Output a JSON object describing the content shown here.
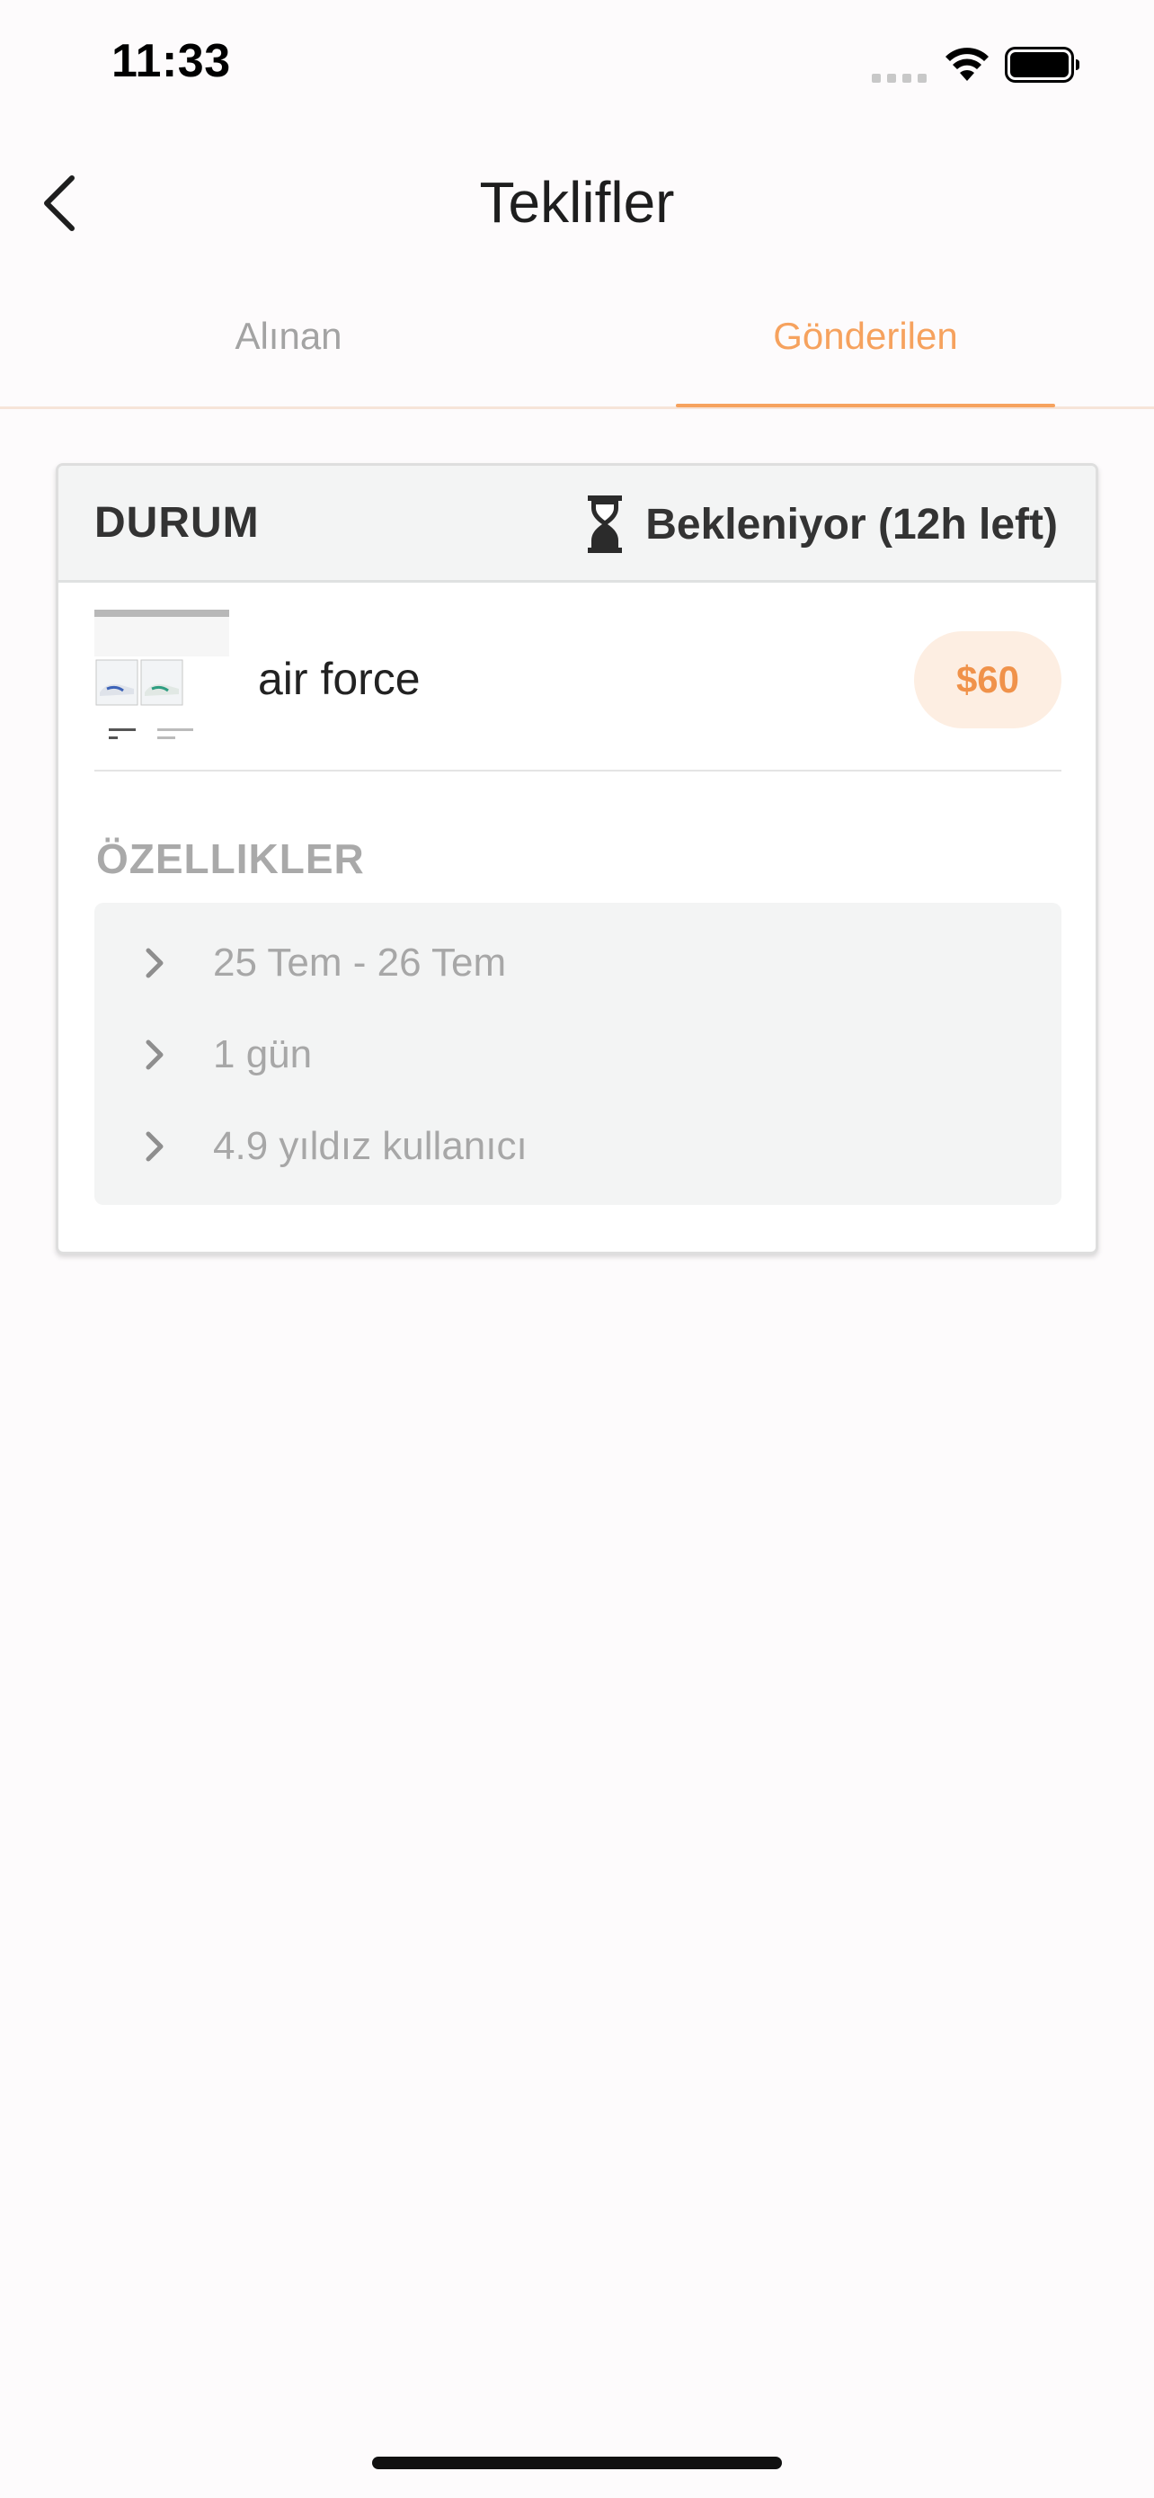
{
  "status_bar": {
    "time": "11:33"
  },
  "nav": {
    "title": "Teklifler"
  },
  "tabs": [
    {
      "label": "Alınan",
      "active": false
    },
    {
      "label": "Gönderilen",
      "active": true
    }
  ],
  "offer": {
    "status_label": "DURUM",
    "status_value": "Bekleniyor (12h left)",
    "product_name": "air force",
    "price": "$60",
    "features_title": "ÖZELLIKLER",
    "features": [
      "25 Tem - 26 Tem",
      "1 gün",
      "4.9 yıldız kullanıcı"
    ]
  },
  "colors": {
    "accent": "#f6a25e",
    "price_bg": "#fdeee2",
    "card_header_bg": "#f3f4f4"
  },
  "icons": {
    "back": "chevron-left-icon",
    "status": "hourglass-icon",
    "feature": "chevron-right-icon"
  }
}
